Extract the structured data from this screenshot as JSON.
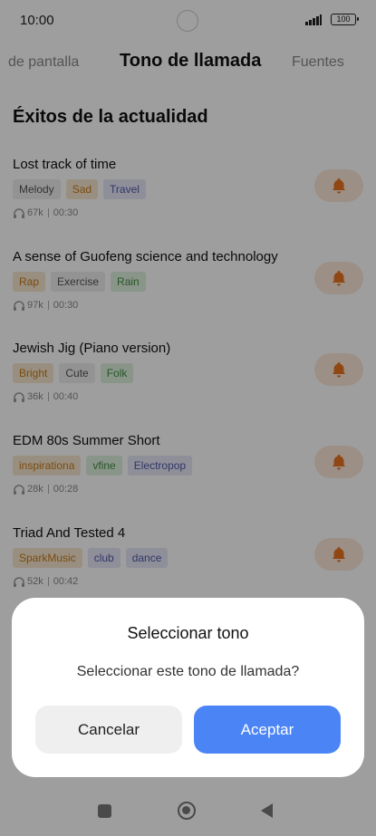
{
  "status": {
    "time": "10:00",
    "battery": "100"
  },
  "tabs": {
    "left": "de pantalla",
    "center": "Tono de llamada",
    "right": "Fuentes"
  },
  "section_title": "Éxitos de la actualidad",
  "songs": [
    {
      "name": "Lost track of time",
      "tags": [
        "Melody",
        "Sad",
        "Travel"
      ],
      "plays": "67k",
      "duration": "00:30"
    },
    {
      "name": "A sense of Guofeng science and technology",
      "tags": [
        "Rap",
        "Exercise",
        "Rain"
      ],
      "plays": "97k",
      "duration": "00:30"
    },
    {
      "name": "Jewish Jig (Piano version)",
      "tags": [
        "Bright",
        "Cute",
        "Folk"
      ],
      "plays": "36k",
      "duration": "00:40"
    },
    {
      "name": "EDM 80s Summer Short",
      "tags": [
        "inspirationa",
        "vfine",
        "Electropop"
      ],
      "plays": "28k",
      "duration": "00:28"
    },
    {
      "name": "Triad And Tested 4",
      "tags": [
        "SparkMusic",
        "club",
        "dance"
      ],
      "plays": "52k",
      "duration": "00:42"
    }
  ],
  "dialog": {
    "title": "Seleccionar tono",
    "message": "Seleccionar este tono de llamada?",
    "cancel": "Cancelar",
    "accept": "Aceptar"
  },
  "colors": {
    "accent": "#4a84f5",
    "bell": "#e8731f"
  }
}
